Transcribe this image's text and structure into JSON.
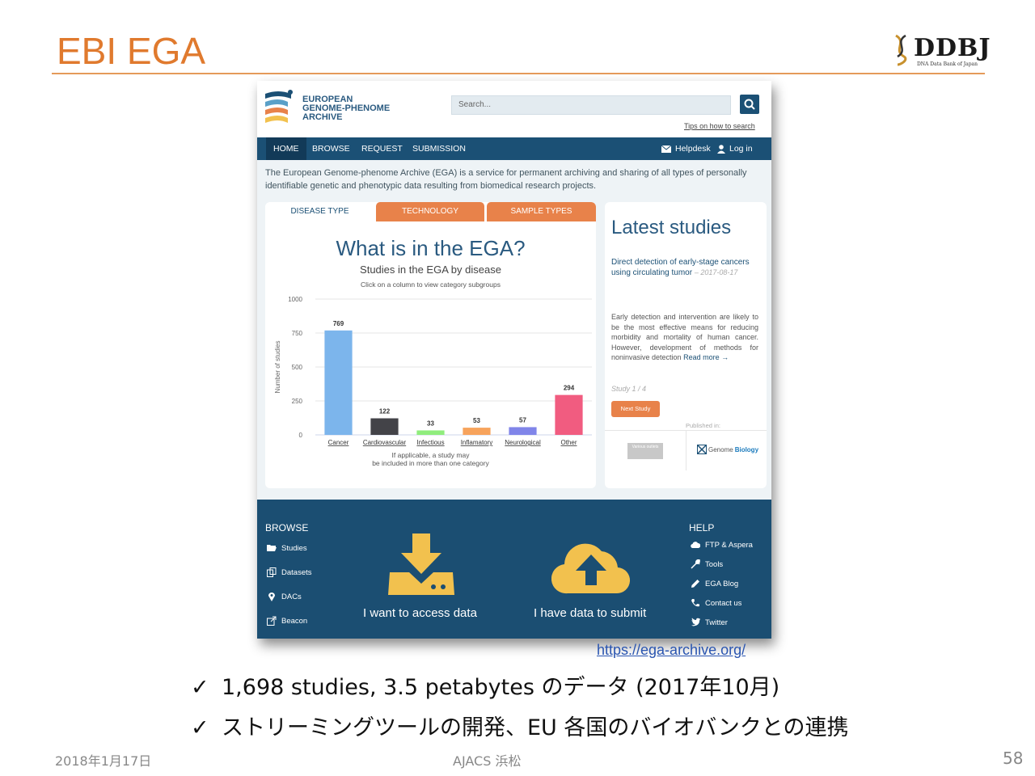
{
  "slide": {
    "title": "EBI EGA",
    "logo": {
      "text": "DDBJ",
      "subtitle": "DNA Data Bank of Japan"
    },
    "url": "https://ega-archive.org/",
    "bullets": [
      "1,698 studies, 3.5 petabytes のデータ (2017年10月)",
      "ストリーミングツールの開発、EU 各国のバイオバンクとの連携"
    ],
    "check_mark": "✓",
    "footer_date": "2018年1月17日",
    "footer_center": "AJACS 浜松",
    "page_number": "58"
  },
  "ega": {
    "logo_lines": [
      "EUROPEAN",
      "GENOME-PHENOME",
      "ARCHIVE"
    ],
    "search": {
      "placeholder": "Search...",
      "tips": "Tips on how to search"
    },
    "nav": {
      "items": [
        "HOME",
        "BROWSE",
        "REQUEST",
        "SUBMISSION"
      ],
      "helpdesk": "Helpdesk",
      "login": "Log in"
    },
    "intro": "The European Genome-phenome Archive (EGA) is a service for permanent archiving and sharing of all types of personally identifiable genetic and phenotypic data resulting from biomedical research projects.",
    "tabs": [
      "DISEASE TYPE",
      "TECHNOLOGY",
      "SAMPLE TYPES"
    ],
    "chart_note": [
      "If applicable, a study may",
      "be included in more than one category"
    ],
    "latest": {
      "title": "Latest studies",
      "study_title": "Direct detection of early-stage cancers using circulating tumor",
      "study_date": "– 2017-08-17",
      "body": "Early detection and intervention are likely to be the most effective means for reducing morbidity and mortality of human cancer. However, development of methods for noninvasive detection",
      "read_more": "Read more →",
      "count": "Study 1 / 4",
      "next_button": "Next Study",
      "published_in": "Published in:",
      "grey_logo": "Various outlets",
      "journal": {
        "part1": "Genome",
        "part2": "Biology"
      }
    },
    "footer": {
      "browse_heading": "BROWSE",
      "browse_items": [
        "Studies",
        "Datasets",
        "DACs",
        "Beacon"
      ],
      "access_label": "I want to access data",
      "submit_label": "I have data to submit",
      "help_heading": "HELP",
      "help_items": [
        "FTP & Aspera",
        "Tools",
        "EGA Blog",
        "Contact us",
        "Twitter"
      ]
    }
  },
  "colors": {
    "accent_orange": "#e07a2e",
    "ega_blue": "#1b5075",
    "tab_orange": "#e8824a",
    "footer_blue": "#1b4e72",
    "icon_yellow": "#f2c14e"
  },
  "chart_data": {
    "type": "bar",
    "title": "What is in the EGA?",
    "subtitle": "Studies in the EGA by disease",
    "hint": "Click on a column to view category subgroups",
    "ylabel": "Number of studies",
    "xlabel": "",
    "ylim": [
      0,
      1000
    ],
    "yticks": [
      0,
      250,
      500,
      750,
      1000
    ],
    "categories": [
      "Cancer",
      "Cardiovascular",
      "Infectious",
      "Inflamatory",
      "Neurological",
      "Other"
    ],
    "values": [
      769,
      122,
      33,
      53,
      57,
      294
    ],
    "colors": [
      "#7cb5ec",
      "#434348",
      "#90ed7d",
      "#f7a35c",
      "#8085e9",
      "#f15c80"
    ],
    "grid": true
  }
}
